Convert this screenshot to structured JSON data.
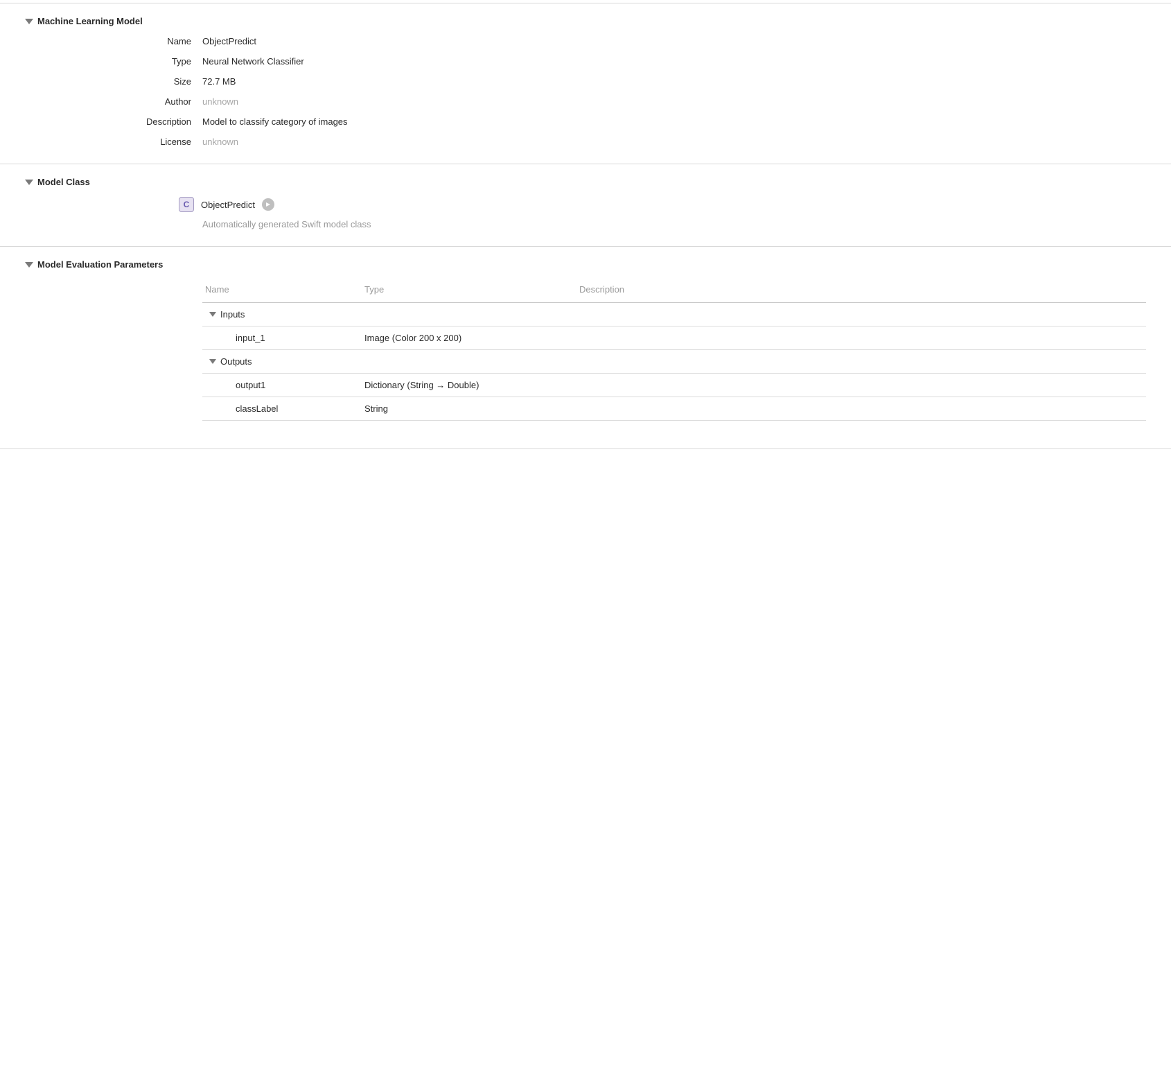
{
  "section1": {
    "title": "Machine Learning Model",
    "fields": {
      "name": {
        "label": "Name",
        "value": "ObjectPredict",
        "placeholder": false
      },
      "type": {
        "label": "Type",
        "value": "Neural Network Classifier",
        "placeholder": false
      },
      "size": {
        "label": "Size",
        "value": "72.7 MB",
        "placeholder": false
      },
      "author": {
        "label": "Author",
        "value": "unknown",
        "placeholder": true
      },
      "description": {
        "label": "Description",
        "value": "Model to classify category of images",
        "placeholder": false
      },
      "license": {
        "label": "License",
        "value": "unknown",
        "placeholder": true
      }
    }
  },
  "section2": {
    "title": "Model Class",
    "class_name": "ObjectPredict",
    "class_letter": "C",
    "subtitle": "Automatically generated Swift model class"
  },
  "section3": {
    "title": "Model Evaluation Parameters",
    "columns": {
      "name": "Name",
      "type": "Type",
      "description": "Description"
    },
    "groups": [
      {
        "label": "Inputs",
        "rows": [
          {
            "name": "input_1",
            "type": "Image (Color 200 x 200)",
            "description": ""
          }
        ]
      },
      {
        "label": "Outputs",
        "rows": [
          {
            "name": "output1",
            "type": "Dictionary (String → Double)",
            "description": ""
          },
          {
            "name": "classLabel",
            "type": "String",
            "description": ""
          }
        ]
      }
    ]
  }
}
